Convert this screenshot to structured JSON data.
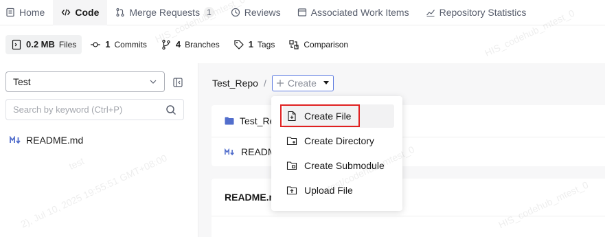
{
  "topnav": {
    "tabs": [
      {
        "label": "Home",
        "icon": "document-icon"
      },
      {
        "label": "Code",
        "icon": "code-icon"
      },
      {
        "label": "Merge Requests",
        "icon": "merge-request-icon",
        "badge": "1"
      },
      {
        "label": "Reviews",
        "icon": "review-icon"
      },
      {
        "label": "Associated Work Items",
        "icon": "work-items-icon"
      },
      {
        "label": "Repository Statistics",
        "icon": "statistics-icon"
      }
    ],
    "active_tab": "Code"
  },
  "stats": {
    "files": {
      "value": "0.2 MB",
      "label": "Files"
    },
    "commits": {
      "value": "1",
      "label": "Commits"
    },
    "branches": {
      "value": "4",
      "label": "Branches"
    },
    "tags": {
      "value": "1",
      "label": "Tags"
    },
    "comparison": {
      "label": "Comparison"
    }
  },
  "sidebar": {
    "branch": "Test",
    "search_placeholder": "Search by keyword (Ctrl+P)",
    "files": [
      {
        "name": "README.md",
        "icon": "markdown-icon"
      }
    ]
  },
  "breadcrumb": {
    "repo": "Test_Repo",
    "separator": "/",
    "create_label": "Create"
  },
  "main": {
    "card_title": "Test_Re",
    "card_row": "READM",
    "readme_title": "README.r"
  },
  "create_menu": {
    "items": [
      {
        "label": "Create File",
        "icon": "new-file-icon"
      },
      {
        "label": "Create Directory",
        "icon": "new-folder-icon"
      },
      {
        "label": "Create Submodule",
        "icon": "submodule-icon"
      },
      {
        "label": "Upload File",
        "icon": "upload-icon"
      }
    ]
  },
  "watermark": {
    "line1": "HIS_codehub_mtest_0",
    "line2": "test",
    "line3": "2), Jul 10, 2025 19:55:51 GMT+08:00",
    "line4": "mtest/codehub_mtest_0"
  },
  "colors": {
    "accent": "#5e7ce0",
    "highlight_box": "#e02020",
    "folder": "#526ecc",
    "markdown": "#526ecc"
  }
}
